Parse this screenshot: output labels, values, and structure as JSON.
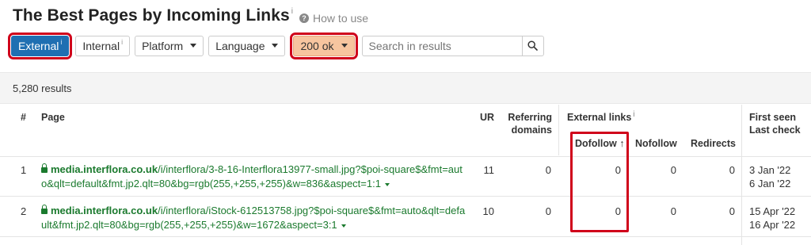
{
  "header": {
    "title": "The Best Pages by Incoming Links",
    "title_info": "i",
    "howto_icon": "?",
    "howto_label": "How to use"
  },
  "filters": {
    "external_label": "External",
    "external_info": "i",
    "internal_label": "Internal",
    "internal_info": "i",
    "platform_label": "Platform",
    "language_label": "Language",
    "status_label": "200 ok",
    "search_placeholder": "Search in results"
  },
  "results": {
    "count_label": "5,280 results"
  },
  "table": {
    "headers": {
      "num": "#",
      "page": "Page",
      "ur": "UR",
      "referring_line1": "Referring",
      "referring_line2": "domains",
      "external_links": "External links",
      "external_links_info": "i",
      "first_seen": "First seen",
      "last_check": "Last check",
      "dofollow": "Dofollow",
      "dofollow_sort": "↑",
      "nofollow": "Nofollow",
      "redirects": "Redirects"
    },
    "rows": [
      {
        "num": "1",
        "domain": "media.interflora.co.uk",
        "path_line1": "/i/interflora/3-8-16-Interflora13977-small.jpg?$poi-square$&fmt=aut",
        "path_line2": "o&qlt=default&fmt.jp2.qlt=80&bg=rgb(255,+255,+255)&w=836&aspect=1:1",
        "ur": "11",
        "referring_domains": "0",
        "dofollow": "0",
        "nofollow": "0",
        "redirects": "0",
        "first_seen": "3 Jan '22",
        "last_check": "6 Jan '22"
      },
      {
        "num": "2",
        "domain": "media.interflora.co.uk",
        "path_line1": "/i/interflora/iStock-612513758.jpg?$poi-square$&fmt=auto&qlt=defa",
        "path_line2": "ult&fmt.jp2.qlt=80&bg=rgb(255,+255,+255)&w=1672&aspect=3:1",
        "ur": "10",
        "referring_domains": "0",
        "dofollow": "0",
        "nofollow": "0",
        "redirects": "0",
        "first_seen": "15 Apr '22",
        "last_check": "16 Apr '22"
      }
    ]
  },
  "colors": {
    "accent_blue": "#1f6fb2",
    "link_green": "#1b7a2e",
    "highlight_red": "#d0021b",
    "status_orange": "#f7c59f"
  }
}
